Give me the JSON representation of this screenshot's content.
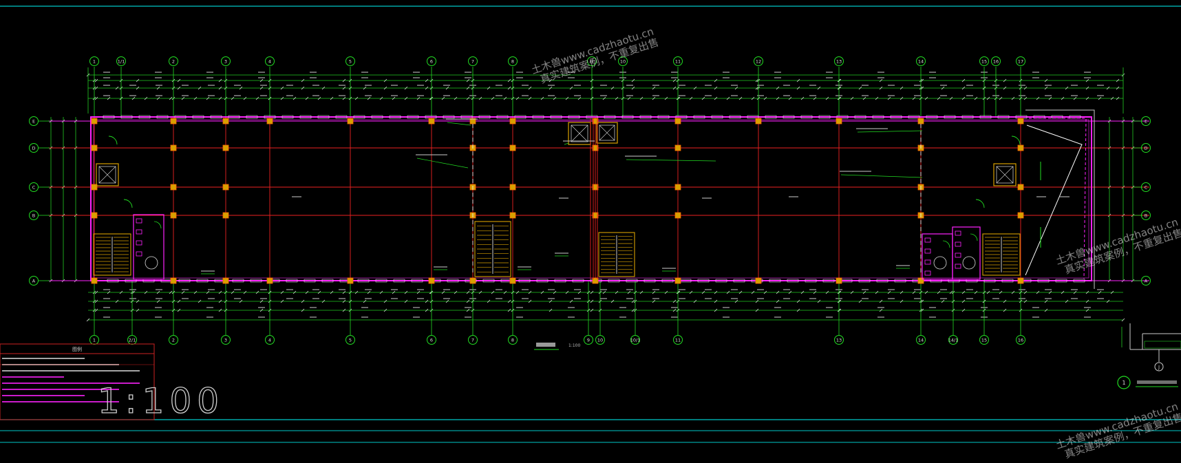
{
  "colors": {
    "background": "#000000",
    "frame": "#00c8c8",
    "grid_axis": "#22dd22",
    "column_grid": "#ee2222",
    "wall": "#ff22ff",
    "column": "#d8a000",
    "dimension": "#22cc22",
    "text": "#cccccc",
    "table_border": "#cc2222",
    "title_block_text": "#cfcfcf"
  },
  "axes_top": [
    "1",
    "1/1",
    "2",
    "3",
    "4",
    "5",
    "6",
    "7",
    "8",
    "9",
    "10",
    "11",
    "12",
    "13",
    "14",
    "15",
    "16",
    "17"
  ],
  "axes_bottom": [
    "1",
    "2/1",
    "2",
    "3",
    "4",
    "5",
    "6",
    "7",
    "8",
    "9",
    "10",
    "10/1",
    "11",
    "13",
    "14",
    "14/1",
    "15",
    "16"
  ],
  "axes_rows": [
    "E",
    "D",
    "C",
    "B",
    "A"
  ],
  "detail_marker": "J",
  "detail_number": "1",
  "scale_label": "1:100",
  "legend_table_title": "图例",
  "watermark": {
    "line1": "土木兽www.cadzhaotu.cn",
    "line2": "真实建筑案例，不重复出售"
  },
  "icons": [
    "stair-icon",
    "elevator-icon",
    "toilet-icon",
    "door-swing-icon"
  ]
}
